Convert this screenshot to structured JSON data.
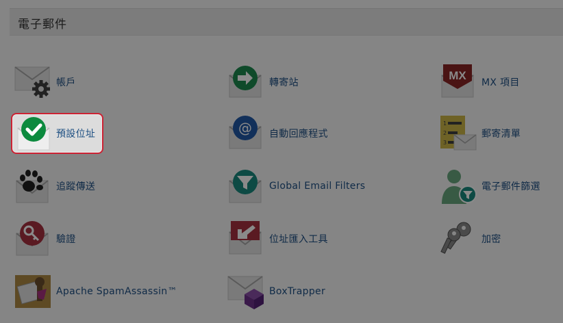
{
  "section": {
    "title": "電子郵件"
  },
  "items": [
    {
      "label": "帳戶",
      "icon": "envelope-gear-icon"
    },
    {
      "label": "轉寄站",
      "icon": "envelope-forward-arrow-icon"
    },
    {
      "label": "MX 項目",
      "icon": "envelope-mx-icon"
    },
    {
      "label": "預設位址",
      "icon": "envelope-checkmark-icon"
    },
    {
      "label": "自動回應程式",
      "icon": "envelope-at-sign-icon"
    },
    {
      "label": "郵寄清單",
      "icon": "mailing-list-icon"
    },
    {
      "label": "追蹤傳送",
      "icon": "envelope-pawprint-icon"
    },
    {
      "label": "Global Email Filters",
      "icon": "envelope-funnel-icon"
    },
    {
      "label": "電子郵件篩選",
      "icon": "user-funnel-icon"
    },
    {
      "label": "驗證",
      "icon": "envelope-key-icon"
    },
    {
      "label": "位址匯入工具",
      "icon": "envelope-import-arrow-icon"
    },
    {
      "label": "加密",
      "icon": "keys-icon"
    },
    {
      "label": "Apache SpamAssassin™",
      "icon": "spamassassin-icon"
    },
    {
      "label": "BoxTrapper",
      "icon": "envelope-box-icon"
    }
  ],
  "colors": {
    "overlay_bg": "#858585",
    "highlight_border": "#cc2233",
    "link_text": "#0f2a47"
  }
}
